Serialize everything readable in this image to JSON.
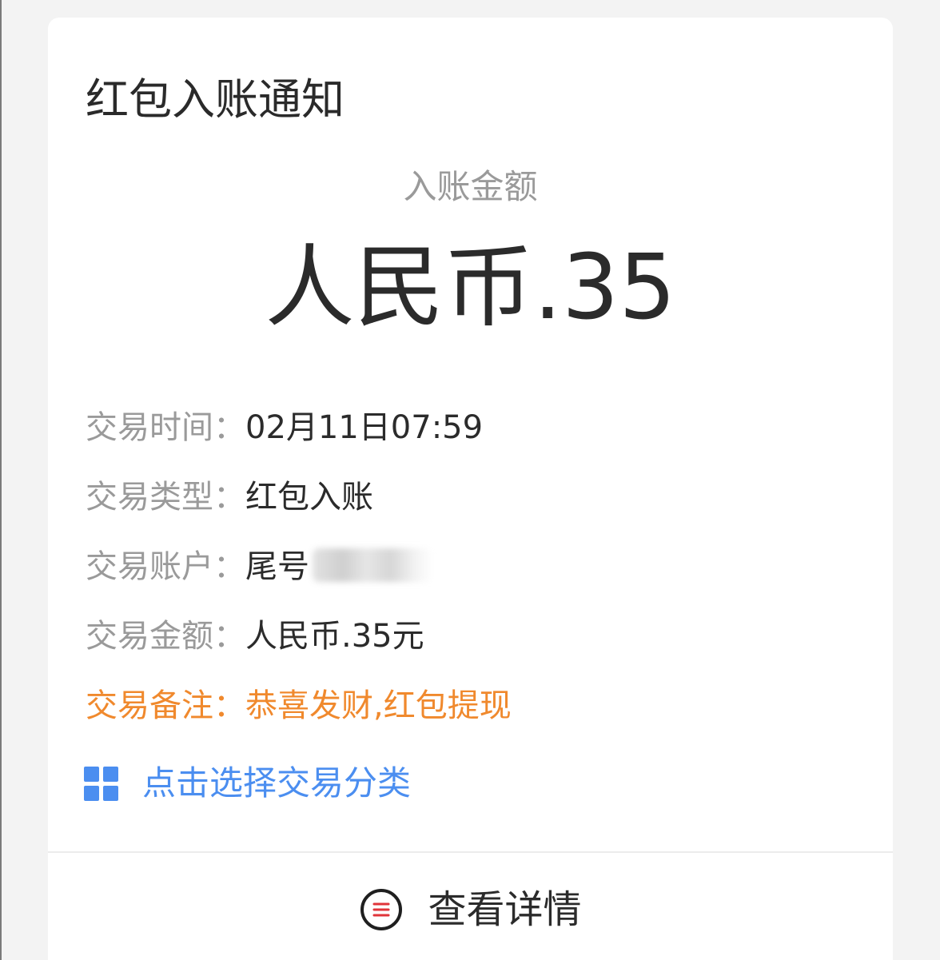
{
  "card": {
    "title": "红包入账通知",
    "amount_label": "入账金额",
    "amount_value": "人民币.35"
  },
  "fields": [
    {
      "label": "交易时间：",
      "value": "02月11日07:59"
    },
    {
      "label": "交易类型：",
      "value": "红包入账"
    },
    {
      "label": "交易账户：",
      "value": "尾号"
    },
    {
      "label": "交易金额：",
      "value": "人民币.35元"
    },
    {
      "label": "交易备注：",
      "value": "恭喜发财,红包提现"
    }
  ],
  "category": {
    "label": "点击选择交易分类",
    "icon": "grid-icon",
    "color": "#4b8ef0"
  },
  "footer": {
    "details_label": "查看详情",
    "icon": "list-circle-icon"
  },
  "colors": {
    "remark": "#f0892d",
    "label_gray": "#9a9a9a",
    "text_dark": "#2b2b2b"
  }
}
